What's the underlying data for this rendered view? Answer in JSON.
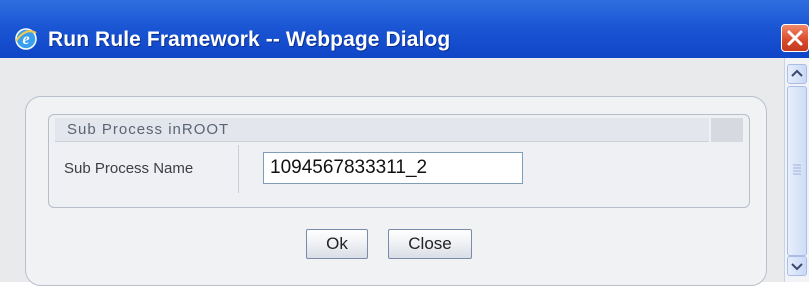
{
  "window": {
    "title": "Run Rule Framework -- Webpage Dialog",
    "app_icon": "ie-icon",
    "close_icon": "close-icon"
  },
  "section": {
    "header": "Sub Process inROOT"
  },
  "form": {
    "sub_process_name_label": "Sub Process Name",
    "sub_process_name_value": "1094567833311_2"
  },
  "buttons": {
    "ok_label": "Ok",
    "close_label": "Close"
  },
  "scrollbar": {
    "up_icon": "chevron-up-icon",
    "down_icon": "chevron-down-icon",
    "grip_icon": "grip-icon"
  },
  "colors": {
    "titlebar": "#1b56d4",
    "title_text": "#ffffff",
    "close_button": "#d9482a",
    "dialog_bg": "#e9eaec",
    "panel_bg": "#f1f2f4",
    "input_border": "#7f9db9"
  }
}
